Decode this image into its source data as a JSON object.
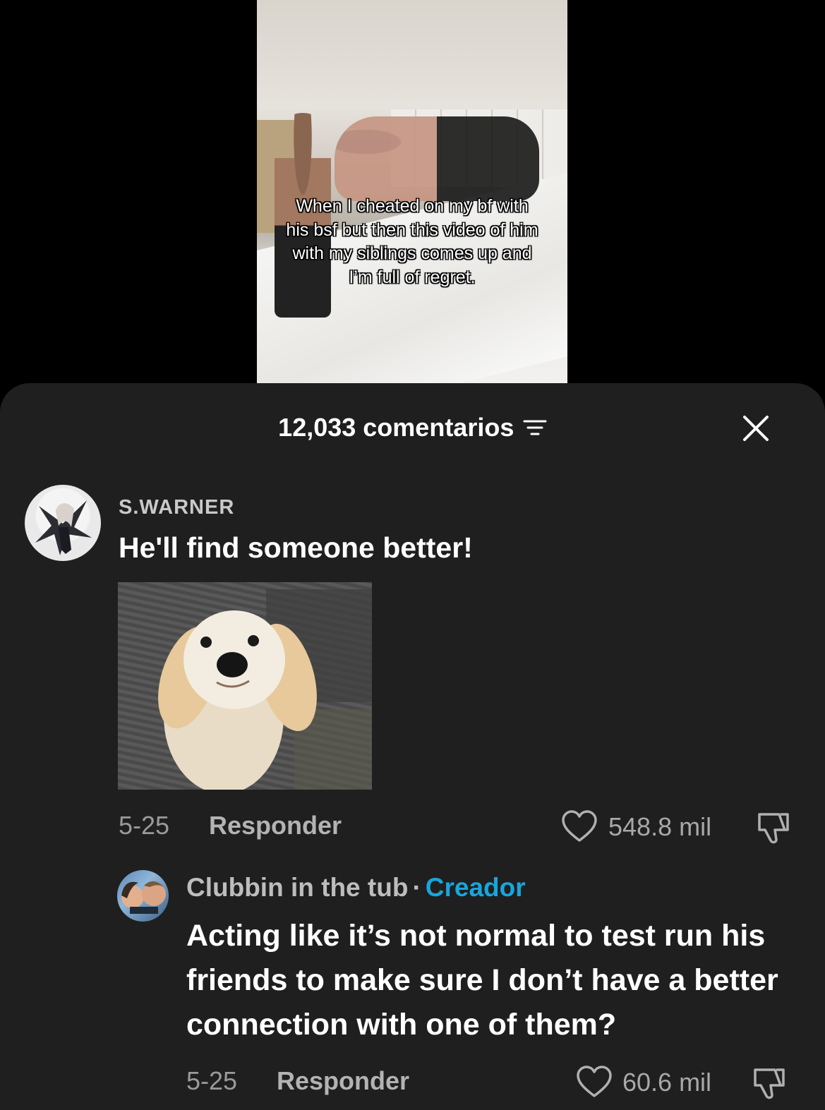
{
  "video": {
    "caption": "When I cheated on my bf with his bsf but then this video of him with my siblings comes up and I’m full of regret."
  },
  "comments_header": {
    "count_label": "12,033 comentarios",
    "filter_icon": "filter-icon",
    "close_icon": "close-icon"
  },
  "comments": [
    {
      "username": "S.WARNER",
      "text": "He'll find someone better!",
      "attachment": "dog-photo",
      "date": "5-25",
      "reply_label": "Responder",
      "likes": "548.8 mil"
    },
    {
      "username": "Clubbin in the tub",
      "separator": "·",
      "badge": "Creador",
      "text": "Acting like it’s not normal to test run his friends to make sure I don’t have a better connection with one of them?",
      "date": "5-25",
      "reply_label": "Responder",
      "likes": "60.6 mil"
    }
  ],
  "colors": {
    "sheet_bg": "#1f1f1f",
    "creator_badge": "#18a6dc",
    "muted_text": "#9a9a9a"
  }
}
